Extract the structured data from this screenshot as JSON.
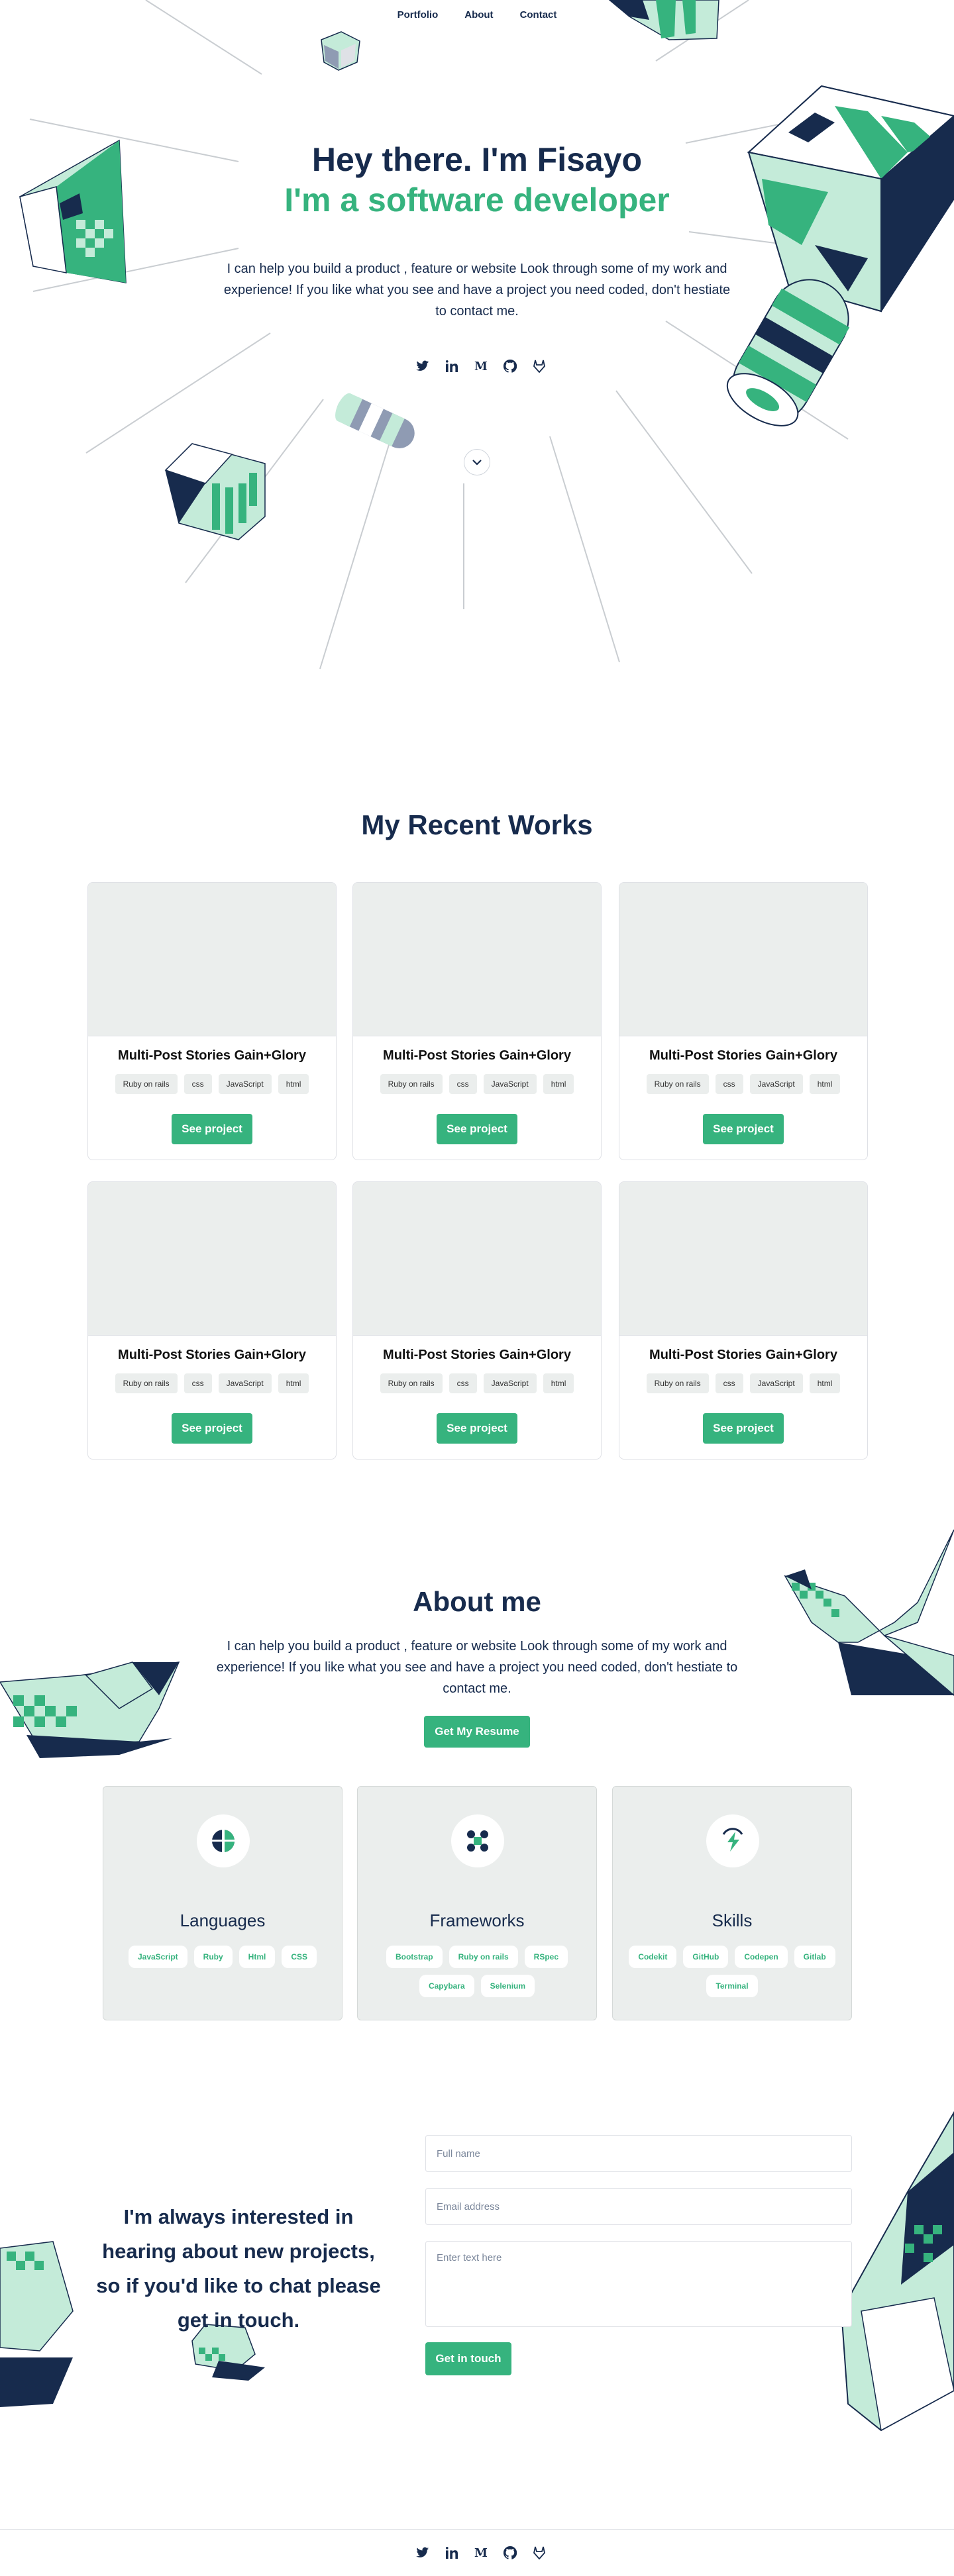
{
  "nav": {
    "items": [
      "Portfolio",
      "About",
      "Contact"
    ]
  },
  "hero": {
    "title": "Hey there. I'm Fisayo",
    "subtitle": "I'm a software developer",
    "text": "I can help you build a product , feature or website Look through some of my work and experience! If you like what you see and have a project you need coded, don't hestiate to contact me."
  },
  "social": {
    "icons": [
      "twitter-icon",
      "linkedin-icon",
      "medium-icon",
      "github-icon",
      "gitlab-icon"
    ],
    "medium_glyph": "M"
  },
  "works": {
    "title": "My Recent Works",
    "projects": [
      {
        "title": "Multi-Post Stories Gain+Glory",
        "tags": [
          "Ruby on rails",
          "css",
          "JavaScript",
          "html"
        ],
        "button": "See project"
      },
      {
        "title": "Multi-Post Stories Gain+Glory",
        "tags": [
          "Ruby on rails",
          "css",
          "JavaScript",
          "html"
        ],
        "button": "See project"
      },
      {
        "title": "Multi-Post Stories Gain+Glory",
        "tags": [
          "Ruby on rails",
          "css",
          "JavaScript",
          "html"
        ],
        "button": "See project"
      },
      {
        "title": "Multi-Post Stories Gain+Glory",
        "tags": [
          "Ruby on rails",
          "css",
          "JavaScript",
          "html"
        ],
        "button": "See project"
      },
      {
        "title": "Multi-Post Stories Gain+Glory",
        "tags": [
          "Ruby on rails",
          "css",
          "JavaScript",
          "html"
        ],
        "button": "See project"
      },
      {
        "title": "Multi-Post Stories Gain+Glory",
        "tags": [
          "Ruby on rails",
          "css",
          "JavaScript",
          "html"
        ],
        "button": "See project"
      }
    ]
  },
  "about": {
    "title": "About me",
    "text": "I can help you build a product , feature or website Look through some of my work and experience! If you like what you see and have a project you need coded, don't hestiate to contact me.",
    "resume_button": "Get My Resume",
    "skills": [
      {
        "title": "Languages",
        "icon": "globe-icon",
        "tags": [
          "JavaScript",
          "Ruby",
          "Html",
          "CSS"
        ]
      },
      {
        "title": "Frameworks",
        "icon": "framework-icon",
        "tags": [
          "Bootstrap",
          "Ruby on rails",
          "RSpec",
          "Capybara",
          "Selenium"
        ]
      },
      {
        "title": "Skills",
        "icon": "lightning-icon",
        "tags": [
          "Codekit",
          "GitHub",
          "Codepen",
          "Gitlab",
          "Terminal"
        ]
      }
    ]
  },
  "contact": {
    "text": "I'm always interested in hearing about new projects, so if you'd like to chat please get in touch.",
    "name_placeholder": "Full name",
    "email_placeholder": "Email address",
    "message_placeholder": "Enter text here",
    "submit": "Get in touch"
  },
  "colors": {
    "navy": "#172b4d",
    "green": "#36b37e",
    "mint": "#c4ebd9",
    "card_gray": "#ebeeed"
  }
}
